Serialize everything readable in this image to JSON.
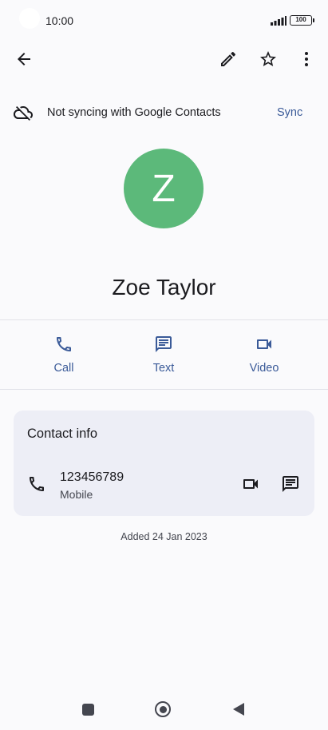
{
  "status_bar": {
    "time": "10:00",
    "battery": "100"
  },
  "sync_banner": {
    "text": "Not syncing with Google Contacts",
    "action": "Sync"
  },
  "contact": {
    "initial": "Z",
    "name": "Zoe Taylor",
    "avatar_color": "#5cb97a"
  },
  "actions": [
    {
      "label": "Call",
      "icon": "phone-icon"
    },
    {
      "label": "Text",
      "icon": "message-icon"
    },
    {
      "label": "Video",
      "icon": "video-icon"
    }
  ],
  "contact_info": {
    "title": "Contact info",
    "phone_number": "123456789",
    "phone_type": "Mobile"
  },
  "added_text": "Added 24 Jan 2023",
  "colors": {
    "accent": "#3a5a98",
    "card_bg": "#edeef6",
    "background": "#fafafc"
  }
}
